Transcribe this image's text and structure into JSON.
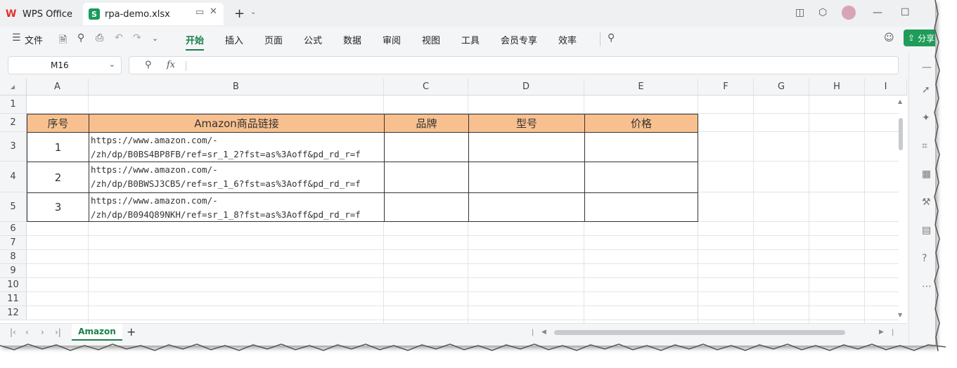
{
  "tabs": {
    "app": "WPS Office",
    "file": "rpa-demo.xlsx",
    "file_badge": "S"
  },
  "ribbon": {
    "file_menu": "文件",
    "menus": [
      "开始",
      "插入",
      "页面",
      "公式",
      "数据",
      "审阅",
      "视图",
      "工具",
      "会员专享",
      "效率"
    ],
    "active": "开始",
    "share": "分享"
  },
  "formula_bar": {
    "cell_ref": "M16",
    "fx": "fx",
    "content": ""
  },
  "grid": {
    "columns": [
      "A",
      "B",
      "C",
      "D",
      "E",
      "F",
      "G",
      "H",
      "I"
    ],
    "rows": [
      "1",
      "2",
      "3",
      "4",
      "5",
      "6",
      "7",
      "8",
      "9",
      "10",
      "11",
      "12"
    ],
    "table_headers": [
      "序号",
      "Amazon商品链接",
      "品牌",
      "型号",
      "价格"
    ],
    "table_rows": [
      {
        "no": "1",
        "link_line1": "https://www.amazon.com/-",
        "link_line2": "/zh/dp/B0BS4BP8FB/ref=sr_1_2?fst=as%3Aoff&pd_rd_r=f"
      },
      {
        "no": "2",
        "link_line1": "https://www.amazon.com/-",
        "link_line2": "/zh/dp/B0BWSJ3CB5/ref=sr_1_6?fst=as%3Aoff&pd_rd_r=f"
      },
      {
        "no": "3",
        "link_line1": "https://www.amazon.com/-",
        "link_line2": "/zh/dp/B094Q89NKH/ref=sr_1_8?fst=as%3Aoff&pd_rd_r=f"
      }
    ]
  },
  "sheets": {
    "active": "Amazon",
    "add": "+"
  },
  "colors": {
    "accent": "#1a7f4b",
    "header_fill": "#f9c08f"
  }
}
